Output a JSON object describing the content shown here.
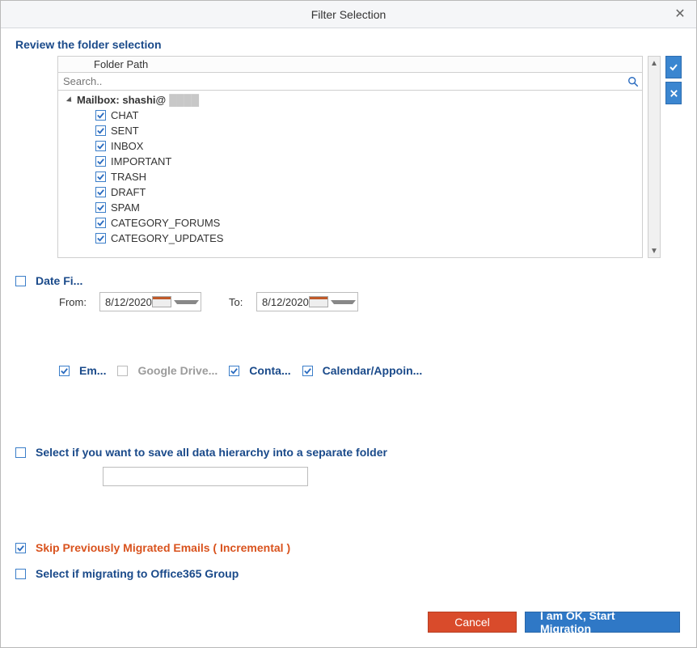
{
  "window": {
    "title": "Filter Selection",
    "close_glyph": "✕"
  },
  "heading": "Review the folder selection",
  "folder_panel": {
    "column_header": "Folder Path",
    "search_placeholder": "Search..",
    "root_label": "Mailbox: shashi@",
    "items": [
      {
        "label": "CHAT",
        "checked": true
      },
      {
        "label": "SENT",
        "checked": true
      },
      {
        "label": "INBOX",
        "checked": true
      },
      {
        "label": "IMPORTANT",
        "checked": true
      },
      {
        "label": "TRASH",
        "checked": true
      },
      {
        "label": "DRAFT",
        "checked": true
      },
      {
        "label": "SPAM",
        "checked": true
      },
      {
        "label": "CATEGORY_FORUMS",
        "checked": true
      },
      {
        "label": "CATEGORY_UPDATES",
        "checked": true
      }
    ]
  },
  "side_buttons": {
    "select_all_title": "Select all",
    "deselect_all_title": "Deselect all"
  },
  "date_filter": {
    "label": "Date Fi...",
    "from_label": "From:",
    "to_label": "To:",
    "from_value": "8/12/2020",
    "to_value": "8/12/2020",
    "checked": false
  },
  "types": {
    "email": {
      "label": "Em...",
      "checked": true,
      "enabled": true
    },
    "gdrive": {
      "label": "Google Drive...",
      "checked": false,
      "enabled": false
    },
    "contacts": {
      "label": "Conta...",
      "checked": true,
      "enabled": true
    },
    "calendar": {
      "label": "Calendar/Appoin...",
      "checked": true,
      "enabled": true
    }
  },
  "hierarchy": {
    "label": "Select if you want to save all data hierarchy into a separate folder",
    "checked": false,
    "value": ""
  },
  "skip": {
    "label": "Skip Previously Migrated Emails ( Incremental )",
    "checked": true
  },
  "o365": {
    "label": "Select if migrating to Office365 Group",
    "checked": false
  },
  "footer": {
    "cancel": "Cancel",
    "ok": "I am OK, Start Migration"
  }
}
